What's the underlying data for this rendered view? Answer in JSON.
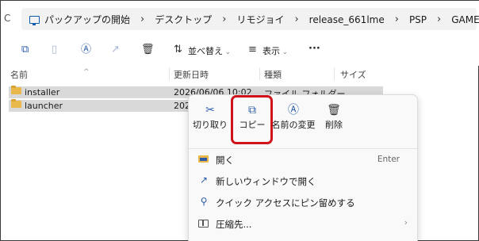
{
  "address": {
    "refresh_icon": "C",
    "crumbs": [
      "パックアップの開始",
      "デスクトップ",
      "リモジョイ",
      "release_661lme",
      "PSP",
      "GAME"
    ]
  },
  "toolbar": {
    "sort_label": "並べ替え",
    "view_label": "表示",
    "more_label": "···"
  },
  "columns": {
    "name": "名前",
    "modified": "更新日時",
    "type": "種類",
    "size": "サイズ"
  },
  "rows": [
    {
      "name": "installer",
      "modified": "2026/06/06 10:02",
      "type": "ファイル フォルダー"
    },
    {
      "name": "launcher",
      "modified": "2026",
      "type": ""
    }
  ],
  "context_menu": {
    "top_buttons": [
      {
        "label": "切り取り",
        "icon": "scissors-icon"
      },
      {
        "label": "コピー",
        "icon": "copy-icon"
      },
      {
        "label": "名前の変更",
        "icon": "rename-icon"
      },
      {
        "label": "削除",
        "icon": "trash-icon"
      }
    ],
    "highlight_color": "#d0121b",
    "items": [
      {
        "label": "開く",
        "shortcut": "Enter",
        "icon": "folder-open-icon"
      },
      {
        "label": "新しいウィンドウで開く",
        "icon": "new-window-icon"
      },
      {
        "label": "クイック アクセスにピン留めする",
        "icon": "pin-icon"
      },
      {
        "label": "圧縮先...",
        "icon": "zip-icon",
        "submenu_arrow": "›"
      }
    ]
  }
}
